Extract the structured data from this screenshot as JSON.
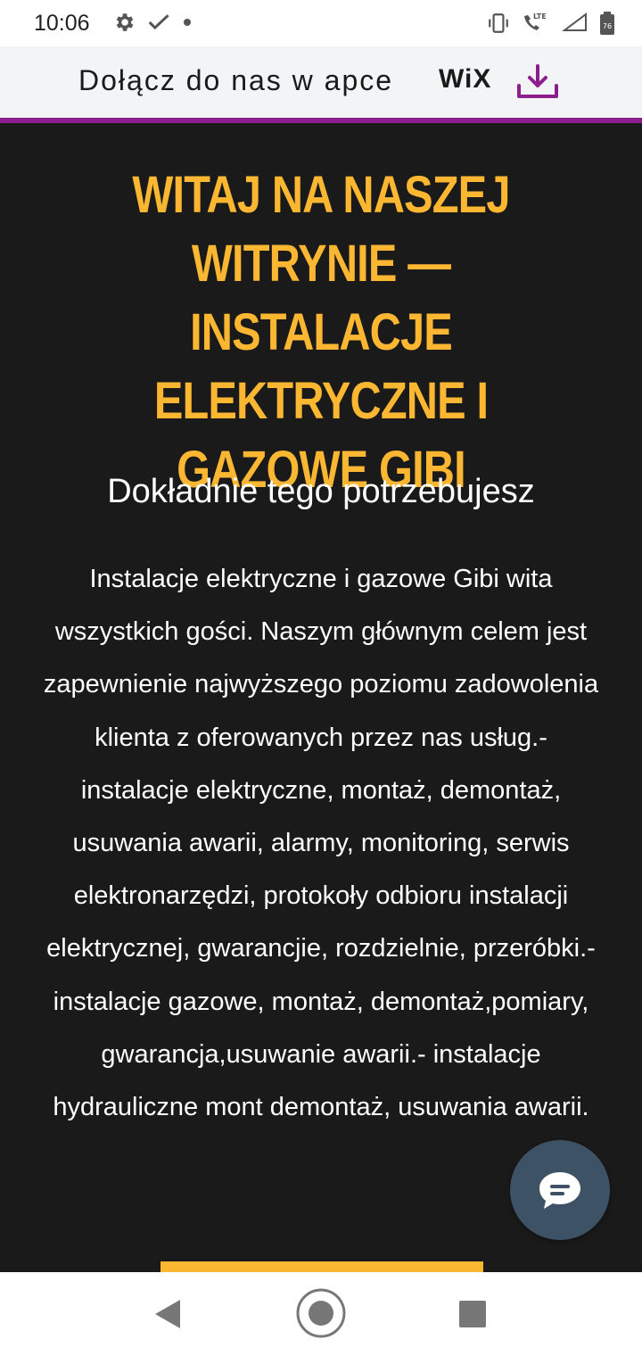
{
  "status_bar": {
    "time": "10:06",
    "left_icons": [
      "gear-icon",
      "check-mark-icon",
      "notification-dot-icon"
    ],
    "right_icons": [
      "vibrate-icon",
      "lte-call-icon",
      "lte-signal-icon",
      "battery-icon"
    ],
    "lte_label": "LTE",
    "battery_level": "76"
  },
  "wix_banner": {
    "text": "Dołącz do nas w apce",
    "logo": "WiX",
    "download_icon": "download-icon",
    "accent_color": "#8d1e8e"
  },
  "hero": {
    "heading": "WITAJ NA NASZEJ WITRYNIE — INSTALACJE ELEKTRYCZNE I GAZOWE GIBI",
    "subheading": "Dokładnie tego potrzebujesz",
    "body": "Instalacje elektryczne i gazowe Gibi wita wszystkich gości. Naszym głównym celem jest zapewnienie najwyższego poziomu zadowolenia klienta z oferowanych przez nas usług.- instalacje elektryczne, montaż, demontaż, usuwania awarii, alarmy, monitoring, serwis elektronarzędzi, protokoły odbioru instalacji elektrycznej, gwarancjie, rozdzielnie, przeróbki.- instalacje gazowe, montaż, demontaż,pomiary, gwarancja,usuwanie awarii.- instalacje hydrauliczne mont demontaż, usuwania awarii.",
    "heading_color": "#fbb731",
    "background_color": "#1b1a1a"
  },
  "chat_button": {
    "icon": "chat-bubble-icon",
    "color": "#3d5265"
  },
  "nav_bar": {
    "back_icon": "back-triangle-icon",
    "home_icon": "home-circle-icon",
    "recents_icon": "recents-square-icon"
  }
}
